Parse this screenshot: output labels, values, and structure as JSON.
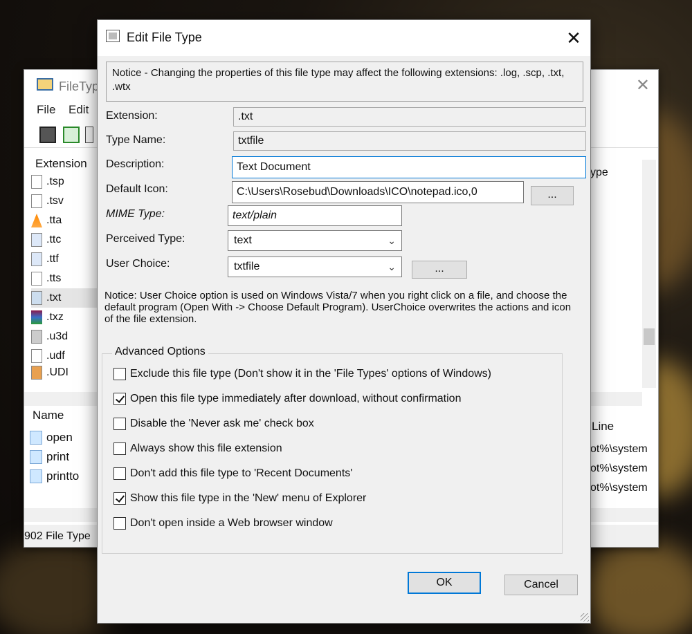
{
  "bg_window": {
    "title": "FileTyp",
    "menu": [
      "File",
      "Edit"
    ],
    "ext_header": "Extension",
    "extensions": [
      ".tsp",
      ".tsv",
      ".tta",
      ".ttc",
      ".ttf",
      ".tts",
      ".txt",
      ".txz",
      ".u3d",
      ".udf",
      ".UDI"
    ],
    "selected_extension": ".txt",
    "right_header": "ype",
    "lower_name_header": "Name",
    "lower_line_header": "Line",
    "actions": [
      "open",
      "print",
      "printto"
    ],
    "command_lines": [
      "ot%\\system",
      "ot%\\system",
      "ot%\\system"
    ],
    "status": "902 File Type"
  },
  "dialog": {
    "title": "Edit File Type",
    "notice": "Notice - Changing the properties of this file type may affect the following extensions: .log, .scp, .txt, .wtx",
    "extension_label": "Extension:",
    "extension_value": ".txt",
    "type_name_label": "Type Name:",
    "type_name_value": "txtfile",
    "description_label": "Description:",
    "description_value": "Text Document",
    "default_icon_label": "Default Icon:",
    "default_icon_value": "C:\\Users\\Rosebud\\Downloads\\ICO\\notepad.ico,0",
    "browse_label": "...",
    "mime_label": "MIME Type:",
    "mime_value": "text/plain",
    "perceived_label": "Perceived Type:",
    "perceived_value": "text",
    "user_choice_label": "User Choice:",
    "user_choice_value": "txtfile",
    "user_choice_button": "...",
    "notice2": "Notice: User Choice option is used on Windows Vista/7 when you right click on a file, and choose the default program (Open With -> Choose Default Program). UserChoice overwrites the actions and icon of the file extension.",
    "advanced_title": "Advanced Options",
    "options": [
      {
        "label": "Exclude  this file type (Don't show it in the 'File Types' options of Windows)",
        "checked": false
      },
      {
        "label": "Open this file type immediately after download, without confirmation",
        "checked": true
      },
      {
        "label": "Disable the 'Never ask me' check box",
        "checked": false
      },
      {
        "label": "Always show this file extension",
        "checked": false
      },
      {
        "label": "Don't add this file type to 'Recent Documents'",
        "checked": false
      },
      {
        "label": "Show this file type in the 'New' menu of Explorer",
        "checked": true
      },
      {
        "label": "Don't open inside a Web browser window",
        "checked": false
      }
    ],
    "ok_label": "OK",
    "cancel_label": "Cancel"
  }
}
